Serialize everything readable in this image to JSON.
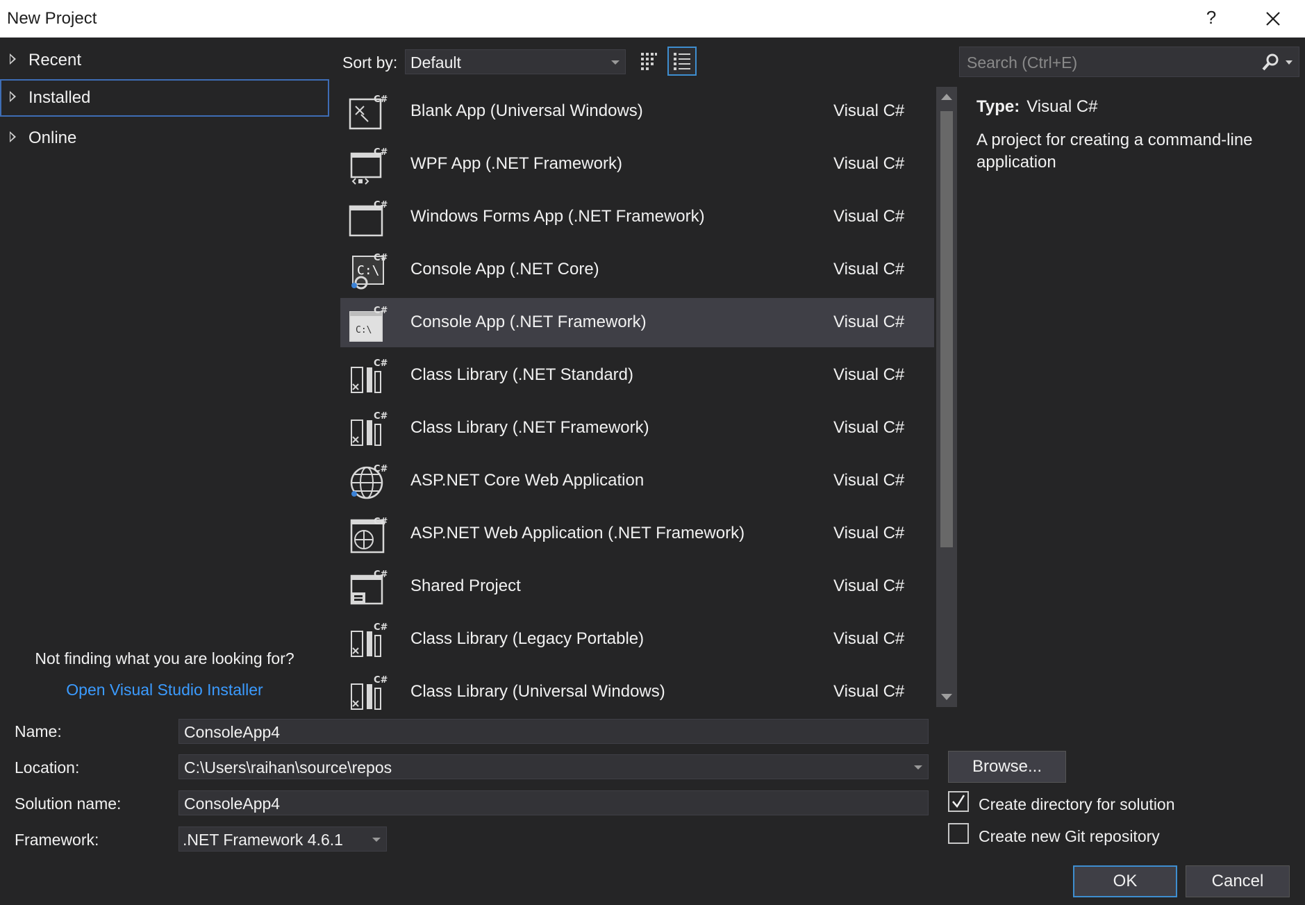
{
  "window": {
    "title": "New Project",
    "help_label": "?"
  },
  "nav": {
    "items": [
      {
        "label": "Recent"
      },
      {
        "label": "Installed"
      },
      {
        "label": "Online"
      }
    ],
    "not_finding": "Not finding what you are looking for?",
    "installer_link": "Open Visual Studio Installer"
  },
  "toolbar": {
    "sort_label": "Sort by:",
    "sort_value": "Default",
    "search_placeholder": "Search (Ctrl+E)"
  },
  "templates": [
    {
      "name": "Blank App (Universal Windows)",
      "lang": "Visual C#",
      "icon": "uwp-app-icon"
    },
    {
      "name": "WPF App (.NET Framework)",
      "lang": "Visual C#",
      "icon": "wpf-app-icon"
    },
    {
      "name": "Windows Forms App (.NET Framework)",
      "lang": "Visual C#",
      "icon": "winforms-app-icon"
    },
    {
      "name": "Console App (.NET Core)",
      "lang": "Visual C#",
      "icon": "console-core-icon"
    },
    {
      "name": "Console App (.NET Framework)",
      "lang": "Visual C#",
      "icon": "console-framework-icon",
      "selected": true
    },
    {
      "name": "Class Library (.NET Standard)",
      "lang": "Visual C#",
      "icon": "class-library-icon"
    },
    {
      "name": "Class Library (.NET Framework)",
      "lang": "Visual C#",
      "icon": "class-library-icon"
    },
    {
      "name": "ASP.NET Core Web Application",
      "lang": "Visual C#",
      "icon": "web-core-icon"
    },
    {
      "name": "ASP.NET Web Application (.NET Framework)",
      "lang": "Visual C#",
      "icon": "web-app-icon"
    },
    {
      "name": "Shared Project",
      "lang": "Visual C#",
      "icon": "shared-project-icon"
    },
    {
      "name": "Class Library (Legacy Portable)",
      "lang": "Visual C#",
      "icon": "class-library-icon"
    },
    {
      "name": "Class Library (Universal Windows)",
      "lang": "Visual C#",
      "icon": "class-library-icon"
    }
  ],
  "description": {
    "type_label": "Type:",
    "type_value": "Visual C#",
    "text": "A project for creating a command-line application"
  },
  "form": {
    "name_label": "Name:",
    "name_value": "ConsoleApp4",
    "location_label": "Location:",
    "location_value": "C:\\Users\\raihan\\source\\repos",
    "solution_label": "Solution name:",
    "solution_value": "ConsoleApp4",
    "framework_label": "Framework:",
    "framework_value": ".NET Framework 4.6.1",
    "browse_label": "Browse...",
    "create_dir_label": "Create directory for solution",
    "create_dir_checked": true,
    "create_git_label": "Create new Git repository",
    "create_git_checked": false,
    "ok_label": "OK",
    "cancel_label": "Cancel"
  },
  "colors": {
    "background": "#252526",
    "selected_row": "#3f3f46",
    "accent": "#3e8ed0",
    "link": "#3b9bff"
  }
}
